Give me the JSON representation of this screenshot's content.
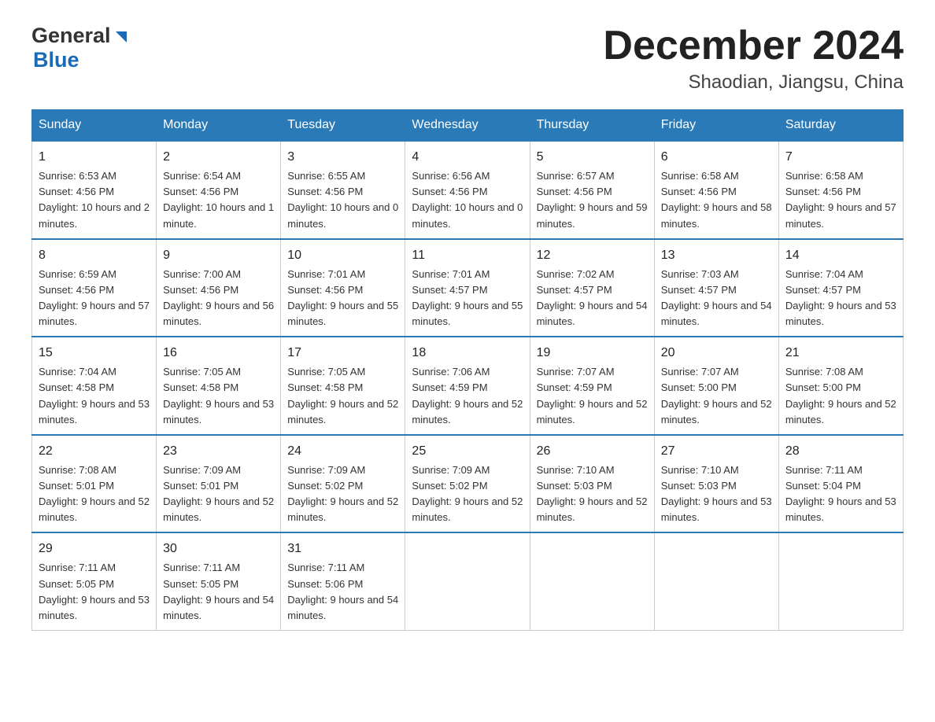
{
  "header": {
    "logo_general": "General",
    "logo_blue": "Blue",
    "month_title": "December 2024",
    "location": "Shaodian, Jiangsu, China"
  },
  "weekdays": [
    "Sunday",
    "Monday",
    "Tuesday",
    "Wednesday",
    "Thursday",
    "Friday",
    "Saturday"
  ],
  "weeks": [
    [
      {
        "day": "1",
        "sunrise": "6:53 AM",
        "sunset": "4:56 PM",
        "daylight": "10 hours and 2 minutes."
      },
      {
        "day": "2",
        "sunrise": "6:54 AM",
        "sunset": "4:56 PM",
        "daylight": "10 hours and 1 minute."
      },
      {
        "day": "3",
        "sunrise": "6:55 AM",
        "sunset": "4:56 PM",
        "daylight": "10 hours and 0 minutes."
      },
      {
        "day": "4",
        "sunrise": "6:56 AM",
        "sunset": "4:56 PM",
        "daylight": "10 hours and 0 minutes."
      },
      {
        "day": "5",
        "sunrise": "6:57 AM",
        "sunset": "4:56 PM",
        "daylight": "9 hours and 59 minutes."
      },
      {
        "day": "6",
        "sunrise": "6:58 AM",
        "sunset": "4:56 PM",
        "daylight": "9 hours and 58 minutes."
      },
      {
        "day": "7",
        "sunrise": "6:58 AM",
        "sunset": "4:56 PM",
        "daylight": "9 hours and 57 minutes."
      }
    ],
    [
      {
        "day": "8",
        "sunrise": "6:59 AM",
        "sunset": "4:56 PM",
        "daylight": "9 hours and 57 minutes."
      },
      {
        "day": "9",
        "sunrise": "7:00 AM",
        "sunset": "4:56 PM",
        "daylight": "9 hours and 56 minutes."
      },
      {
        "day": "10",
        "sunrise": "7:01 AM",
        "sunset": "4:56 PM",
        "daylight": "9 hours and 55 minutes."
      },
      {
        "day": "11",
        "sunrise": "7:01 AM",
        "sunset": "4:57 PM",
        "daylight": "9 hours and 55 minutes."
      },
      {
        "day": "12",
        "sunrise": "7:02 AM",
        "sunset": "4:57 PM",
        "daylight": "9 hours and 54 minutes."
      },
      {
        "day": "13",
        "sunrise": "7:03 AM",
        "sunset": "4:57 PM",
        "daylight": "9 hours and 54 minutes."
      },
      {
        "day": "14",
        "sunrise": "7:04 AM",
        "sunset": "4:57 PM",
        "daylight": "9 hours and 53 minutes."
      }
    ],
    [
      {
        "day": "15",
        "sunrise": "7:04 AM",
        "sunset": "4:58 PM",
        "daylight": "9 hours and 53 minutes."
      },
      {
        "day": "16",
        "sunrise": "7:05 AM",
        "sunset": "4:58 PM",
        "daylight": "9 hours and 53 minutes."
      },
      {
        "day": "17",
        "sunrise": "7:05 AM",
        "sunset": "4:58 PM",
        "daylight": "9 hours and 52 minutes."
      },
      {
        "day": "18",
        "sunrise": "7:06 AM",
        "sunset": "4:59 PM",
        "daylight": "9 hours and 52 minutes."
      },
      {
        "day": "19",
        "sunrise": "7:07 AM",
        "sunset": "4:59 PM",
        "daylight": "9 hours and 52 minutes."
      },
      {
        "day": "20",
        "sunrise": "7:07 AM",
        "sunset": "5:00 PM",
        "daylight": "9 hours and 52 minutes."
      },
      {
        "day": "21",
        "sunrise": "7:08 AM",
        "sunset": "5:00 PM",
        "daylight": "9 hours and 52 minutes."
      }
    ],
    [
      {
        "day": "22",
        "sunrise": "7:08 AM",
        "sunset": "5:01 PM",
        "daylight": "9 hours and 52 minutes."
      },
      {
        "day": "23",
        "sunrise": "7:09 AM",
        "sunset": "5:01 PM",
        "daylight": "9 hours and 52 minutes."
      },
      {
        "day": "24",
        "sunrise": "7:09 AM",
        "sunset": "5:02 PM",
        "daylight": "9 hours and 52 minutes."
      },
      {
        "day": "25",
        "sunrise": "7:09 AM",
        "sunset": "5:02 PM",
        "daylight": "9 hours and 52 minutes."
      },
      {
        "day": "26",
        "sunrise": "7:10 AM",
        "sunset": "5:03 PM",
        "daylight": "9 hours and 52 minutes."
      },
      {
        "day": "27",
        "sunrise": "7:10 AM",
        "sunset": "5:03 PM",
        "daylight": "9 hours and 53 minutes."
      },
      {
        "day": "28",
        "sunrise": "7:11 AM",
        "sunset": "5:04 PM",
        "daylight": "9 hours and 53 minutes."
      }
    ],
    [
      {
        "day": "29",
        "sunrise": "7:11 AM",
        "sunset": "5:05 PM",
        "daylight": "9 hours and 53 minutes."
      },
      {
        "day": "30",
        "sunrise": "7:11 AM",
        "sunset": "5:05 PM",
        "daylight": "9 hours and 54 minutes."
      },
      {
        "day": "31",
        "sunrise": "7:11 AM",
        "sunset": "5:06 PM",
        "daylight": "9 hours and 54 minutes."
      },
      null,
      null,
      null,
      null
    ]
  ],
  "labels": {
    "sunrise": "Sunrise:",
    "sunset": "Sunset:",
    "daylight": "Daylight:"
  }
}
